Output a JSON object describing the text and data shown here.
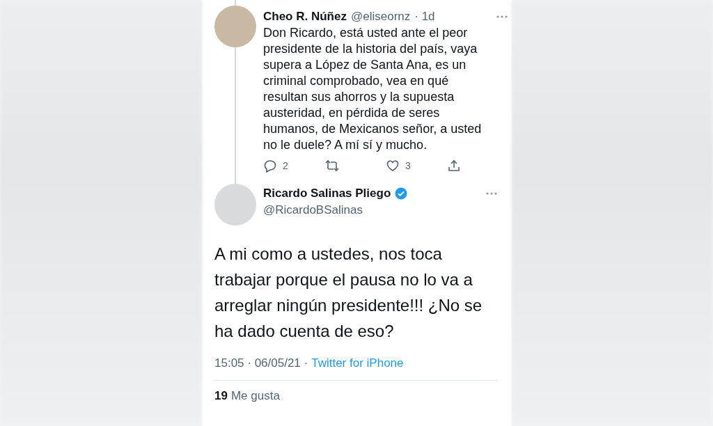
{
  "reply_tweet": {
    "name": "Cheo R. Núñez",
    "handle": "@eliseornz",
    "time": "· 1d",
    "text": "Don Ricardo, está usted ante el peor presidente de la historia del país, vaya supera a López de Santa Ana, es un criminal comprobado, vea en qué resultan sus ahorros y la supuesta austeridad, en pérdida de seres humanos, de Mexicanos señor, a usted no le duele? A mí sí y mucho.",
    "replies": "2",
    "likes": "3"
  },
  "main_tweet": {
    "name": "Ricardo Salinas Pliego",
    "verified": true,
    "handle": "@RicardoBSalinas",
    "text": "A mi como a ustedes, nos toca trabajar porque el pausa no lo va a arreglar ningún presidente!!! ¿No se ha dado cuenta de eso?",
    "timestamp": "15:05 · 06/05/21 ·",
    "source": "Twitter for iPhone",
    "like_count": "19",
    "like_label": "Me gusta"
  }
}
